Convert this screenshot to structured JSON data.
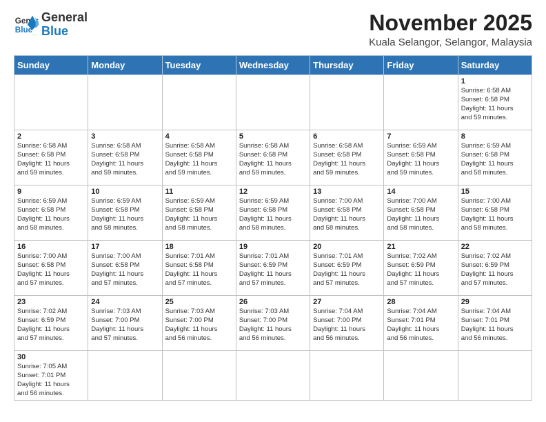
{
  "header": {
    "logo_general": "General",
    "logo_blue": "Blue",
    "month": "November 2025",
    "location": "Kuala Selangor, Selangor, Malaysia"
  },
  "weekdays": [
    "Sunday",
    "Monday",
    "Tuesday",
    "Wednesday",
    "Thursday",
    "Friday",
    "Saturday"
  ],
  "weeks": [
    [
      {
        "day": "",
        "info": ""
      },
      {
        "day": "",
        "info": ""
      },
      {
        "day": "",
        "info": ""
      },
      {
        "day": "",
        "info": ""
      },
      {
        "day": "",
        "info": ""
      },
      {
        "day": "",
        "info": ""
      },
      {
        "day": "1",
        "info": "Sunrise: 6:58 AM\nSunset: 6:58 PM\nDaylight: 11 hours\nand 59 minutes."
      }
    ],
    [
      {
        "day": "2",
        "info": "Sunrise: 6:58 AM\nSunset: 6:58 PM\nDaylight: 11 hours\nand 59 minutes."
      },
      {
        "day": "3",
        "info": "Sunrise: 6:58 AM\nSunset: 6:58 PM\nDaylight: 11 hours\nand 59 minutes."
      },
      {
        "day": "4",
        "info": "Sunrise: 6:58 AM\nSunset: 6:58 PM\nDaylight: 11 hours\nand 59 minutes."
      },
      {
        "day": "5",
        "info": "Sunrise: 6:58 AM\nSunset: 6:58 PM\nDaylight: 11 hours\nand 59 minutes."
      },
      {
        "day": "6",
        "info": "Sunrise: 6:58 AM\nSunset: 6:58 PM\nDaylight: 11 hours\nand 59 minutes."
      },
      {
        "day": "7",
        "info": "Sunrise: 6:59 AM\nSunset: 6:58 PM\nDaylight: 11 hours\nand 59 minutes."
      },
      {
        "day": "8",
        "info": "Sunrise: 6:59 AM\nSunset: 6:58 PM\nDaylight: 11 hours\nand 58 minutes."
      }
    ],
    [
      {
        "day": "9",
        "info": "Sunrise: 6:59 AM\nSunset: 6:58 PM\nDaylight: 11 hours\nand 58 minutes."
      },
      {
        "day": "10",
        "info": "Sunrise: 6:59 AM\nSunset: 6:58 PM\nDaylight: 11 hours\nand 58 minutes."
      },
      {
        "day": "11",
        "info": "Sunrise: 6:59 AM\nSunset: 6:58 PM\nDaylight: 11 hours\nand 58 minutes."
      },
      {
        "day": "12",
        "info": "Sunrise: 6:59 AM\nSunset: 6:58 PM\nDaylight: 11 hours\nand 58 minutes."
      },
      {
        "day": "13",
        "info": "Sunrise: 7:00 AM\nSunset: 6:58 PM\nDaylight: 11 hours\nand 58 minutes."
      },
      {
        "day": "14",
        "info": "Sunrise: 7:00 AM\nSunset: 6:58 PM\nDaylight: 11 hours\nand 58 minutes."
      },
      {
        "day": "15",
        "info": "Sunrise: 7:00 AM\nSunset: 6:58 PM\nDaylight: 11 hours\nand 58 minutes."
      }
    ],
    [
      {
        "day": "16",
        "info": "Sunrise: 7:00 AM\nSunset: 6:58 PM\nDaylight: 11 hours\nand 57 minutes."
      },
      {
        "day": "17",
        "info": "Sunrise: 7:00 AM\nSunset: 6:58 PM\nDaylight: 11 hours\nand 57 minutes."
      },
      {
        "day": "18",
        "info": "Sunrise: 7:01 AM\nSunset: 6:58 PM\nDaylight: 11 hours\nand 57 minutes."
      },
      {
        "day": "19",
        "info": "Sunrise: 7:01 AM\nSunset: 6:59 PM\nDaylight: 11 hours\nand 57 minutes."
      },
      {
        "day": "20",
        "info": "Sunrise: 7:01 AM\nSunset: 6:59 PM\nDaylight: 11 hours\nand 57 minutes."
      },
      {
        "day": "21",
        "info": "Sunrise: 7:02 AM\nSunset: 6:59 PM\nDaylight: 11 hours\nand 57 minutes."
      },
      {
        "day": "22",
        "info": "Sunrise: 7:02 AM\nSunset: 6:59 PM\nDaylight: 11 hours\nand 57 minutes."
      }
    ],
    [
      {
        "day": "23",
        "info": "Sunrise: 7:02 AM\nSunset: 6:59 PM\nDaylight: 11 hours\nand 57 minutes."
      },
      {
        "day": "24",
        "info": "Sunrise: 7:03 AM\nSunset: 7:00 PM\nDaylight: 11 hours\nand 57 minutes."
      },
      {
        "day": "25",
        "info": "Sunrise: 7:03 AM\nSunset: 7:00 PM\nDaylight: 11 hours\nand 56 minutes."
      },
      {
        "day": "26",
        "info": "Sunrise: 7:03 AM\nSunset: 7:00 PM\nDaylight: 11 hours\nand 56 minutes."
      },
      {
        "day": "27",
        "info": "Sunrise: 7:04 AM\nSunset: 7:00 PM\nDaylight: 11 hours\nand 56 minutes."
      },
      {
        "day": "28",
        "info": "Sunrise: 7:04 AM\nSunset: 7:01 PM\nDaylight: 11 hours\nand 56 minutes."
      },
      {
        "day": "29",
        "info": "Sunrise: 7:04 AM\nSunset: 7:01 PM\nDaylight: 11 hours\nand 56 minutes."
      }
    ],
    [
      {
        "day": "30",
        "info": "Sunrise: 7:05 AM\nSunset: 7:01 PM\nDaylight: 11 hours\nand 56 minutes."
      },
      {
        "day": "",
        "info": ""
      },
      {
        "day": "",
        "info": ""
      },
      {
        "day": "",
        "info": ""
      },
      {
        "day": "",
        "info": ""
      },
      {
        "day": "",
        "info": ""
      },
      {
        "day": "",
        "info": ""
      }
    ]
  ]
}
